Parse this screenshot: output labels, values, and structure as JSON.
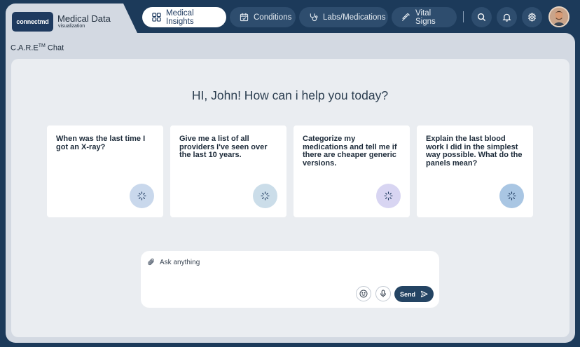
{
  "header": {
    "logo_text": "connectmd",
    "app_title": "Medical Data",
    "app_subtitle": "visualization",
    "nav": [
      {
        "label": "Medical Insights",
        "icon": "grid-icon",
        "active": true
      },
      {
        "label": "Conditions",
        "icon": "calendar-icon",
        "active": false
      },
      {
        "label": "Labs/Medications",
        "icon": "stethoscope-icon",
        "active": false
      },
      {
        "label": "Vital Signs",
        "icon": "syringe-icon",
        "active": false
      }
    ],
    "actions": [
      "search-icon",
      "bell-icon",
      "gear-icon"
    ]
  },
  "panel": {
    "title": "C.A.R.E",
    "title_sup": "TM",
    "title_suffix": " Chat"
  },
  "chat": {
    "greeting": "HI, John! How can i help you today?",
    "cards": [
      {
        "text": "When was the last time I got an X-ray?",
        "button_color": "#c9d8ec"
      },
      {
        "text": "Give me a list of all providers I've seen over the last 10 years.",
        "button_color": "#cbdde9"
      },
      {
        "text": "Categorize my medications and tell me if there are cheaper generic versions.",
        "button_color": "#d8d5f2"
      },
      {
        "text": "Explain the last blood work I did in the simplest way possible. What do the panels mean?",
        "button_color": "#a9c6e3"
      }
    ],
    "input": {
      "placeholder": "Ask anything",
      "send_label": "Send"
    }
  }
}
